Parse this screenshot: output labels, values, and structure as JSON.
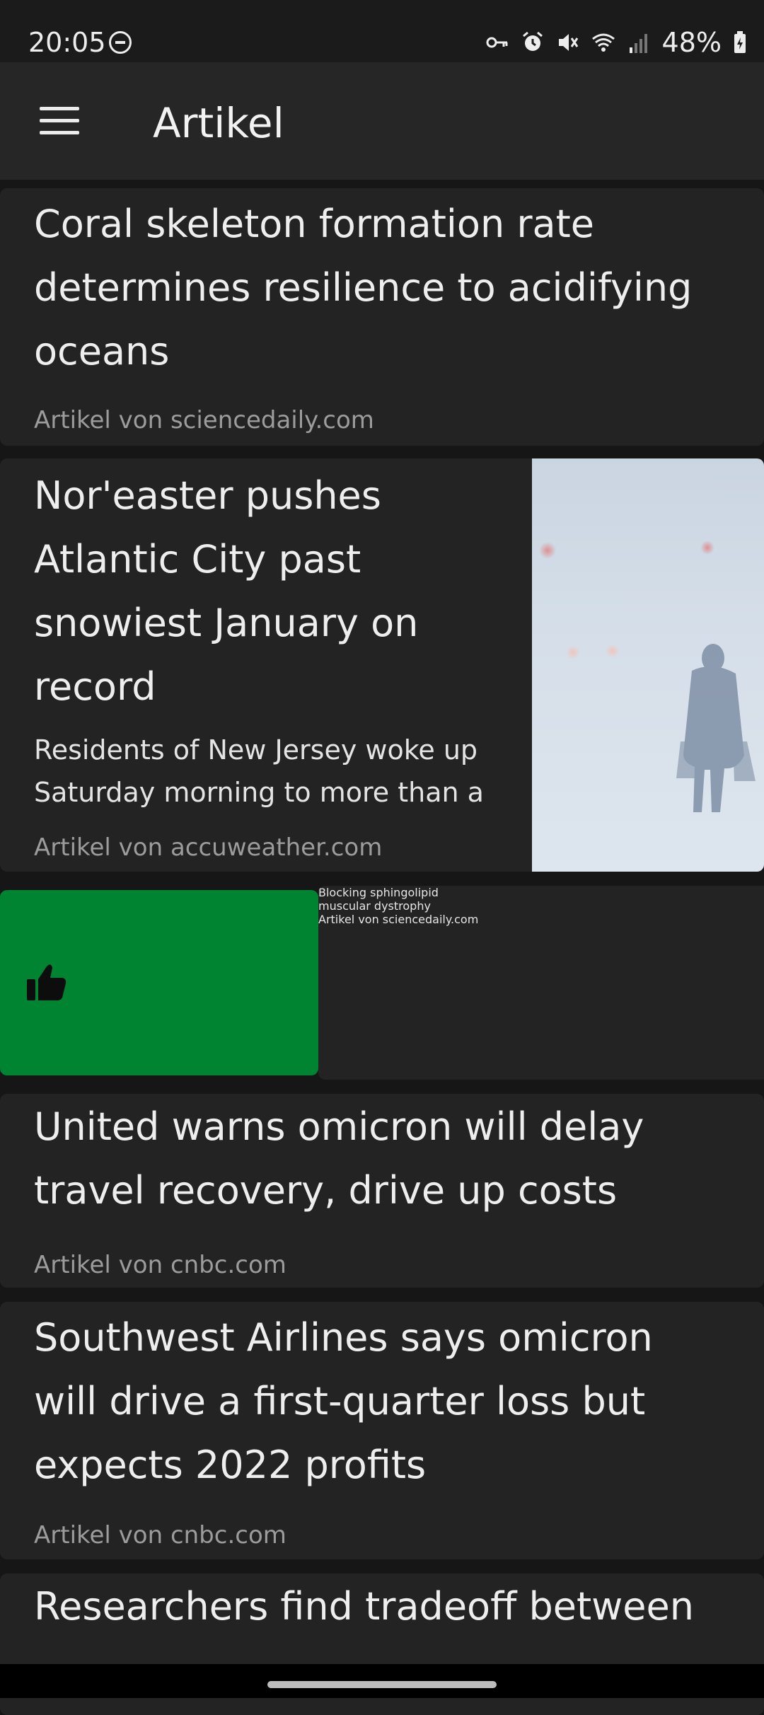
{
  "status_bar": {
    "time": "20:05",
    "battery": "48%"
  },
  "app_bar": {
    "title": "Artikel",
    "menu_icon": "hamburger-menu-icon"
  },
  "articles": [
    {
      "title_lines": [
        "Coral skeleton formation rate",
        "determines resilience to acidifying",
        "oceans"
      ],
      "source": "Artikel von sciencedaily.com"
    },
    {
      "title_lines": [
        "Nor'easter pushes",
        "Atlantic City past",
        "snowiest January on",
        "record"
      ],
      "desc_lines": [
        "Residents of New Jersey woke up",
        "Saturday morning to more than a"
      ],
      "source": "Artikel von accuweather.com"
    },
    {
      "title_lines": [
        "Blocking sphingolipid",
        "muscular dystrophy"
      ],
      "source": "Artikel von sciencedaily.com",
      "swipe_action": "thumbs-up-icon",
      "swipe_color": "#008431"
    },
    {
      "title_lines": [
        "United warns omicron will delay",
        "travel recovery, drive up costs"
      ],
      "source": "Artikel von cnbc.com"
    },
    {
      "title_lines": [
        "Southwest Airlines says omicron",
        "will drive a first-quarter loss but",
        "expects 2022 profits"
      ],
      "source": "Artikel von cnbc.com"
    },
    {
      "title_lines": [
        "Researchers find tradeoff between"
      ]
    }
  ]
}
